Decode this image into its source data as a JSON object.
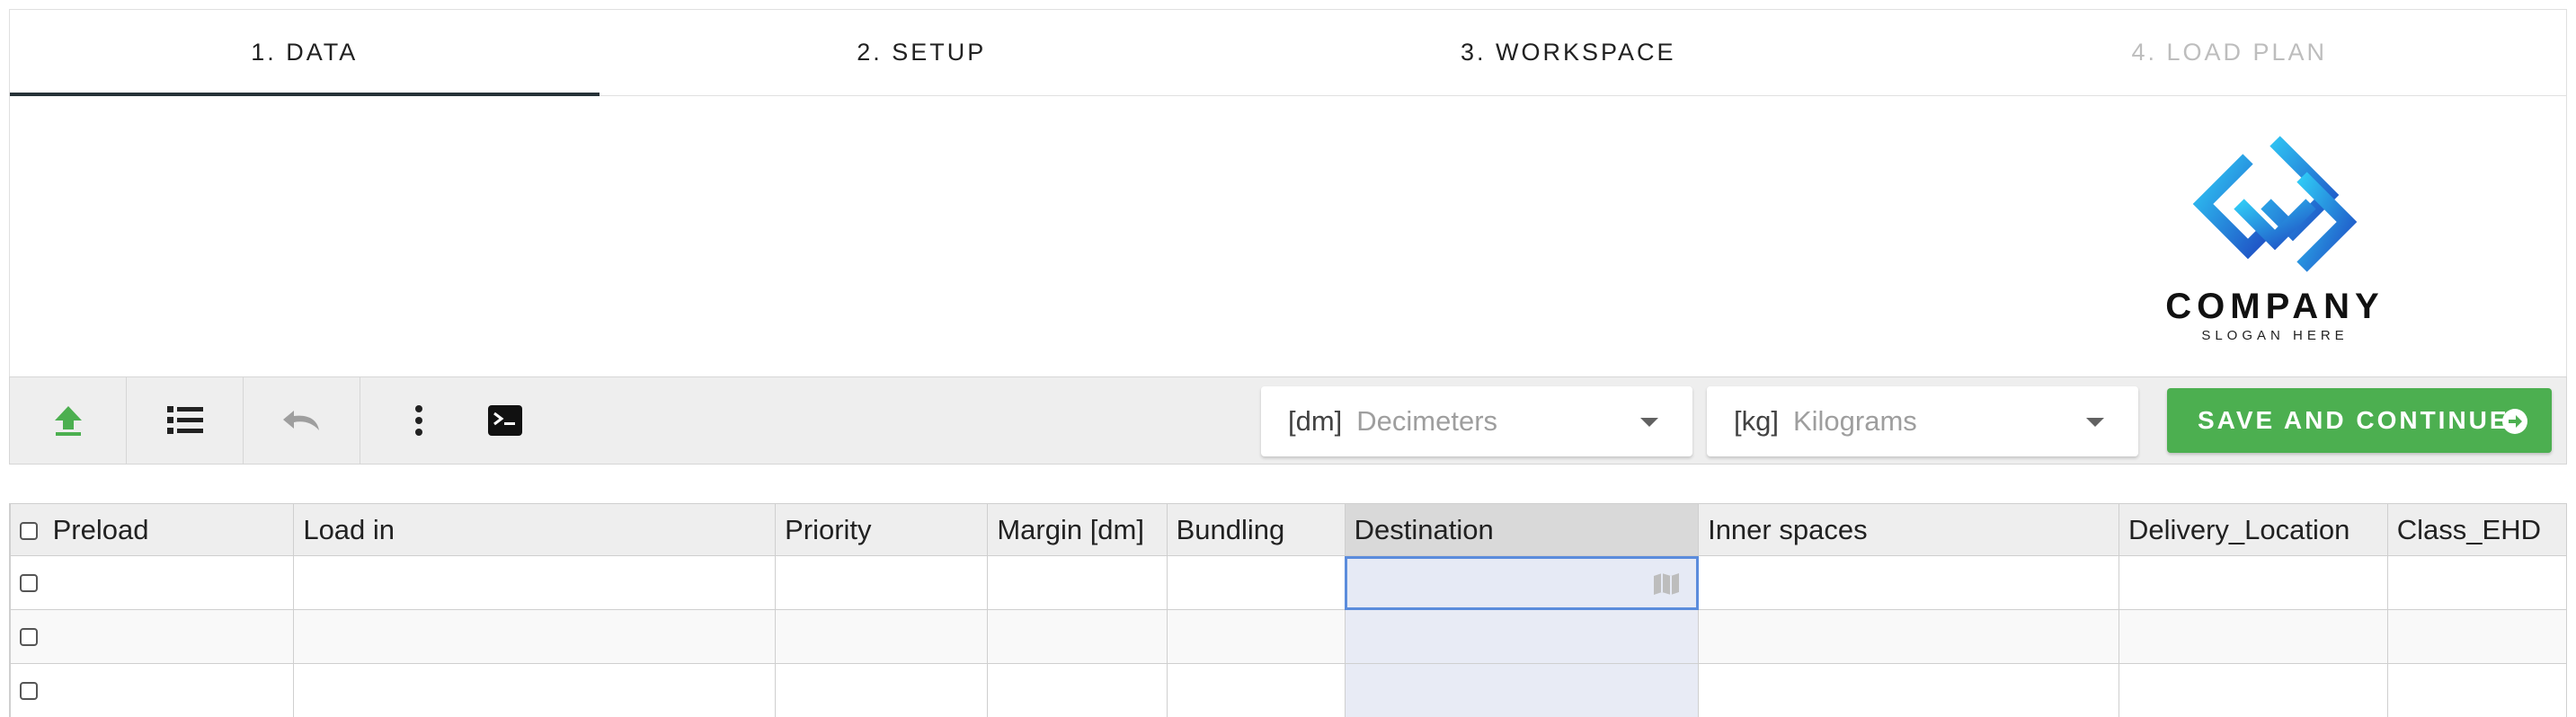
{
  "tabs": [
    {
      "label": "1. DATA",
      "state": "active"
    },
    {
      "label": "2. SETUP",
      "state": "enabled"
    },
    {
      "label": "3. WORKSPACE",
      "state": "enabled"
    },
    {
      "label": "4. LOAD PLAN",
      "state": "disabled"
    }
  ],
  "logo": {
    "name": "COMPANY",
    "slogan": "SLOGAN HERE"
  },
  "toolbar": {
    "buttons": [
      "upload-icon",
      "list-icon",
      "undo-icon",
      "more-vert-icon",
      "console-icon"
    ],
    "length_unit": {
      "unit": "[dm]",
      "value": "Decimeters"
    },
    "weight_unit": {
      "unit": "[kg]",
      "value": "Kilograms"
    },
    "save_label": "SAVE AND CONTINUE"
  },
  "grid": {
    "columns": [
      "Preload",
      "Load in",
      "Priority",
      "Margin [dm]",
      "Bundling",
      "Destination",
      "Inner spaces",
      "Delivery_Location",
      "Class_EHD"
    ],
    "highlighted_column": "Destination",
    "row_count": 3
  },
  "colors": {
    "accent_green": "#4caf50",
    "tab_indicator": "#263238",
    "selection_blue": "#5b8cdc"
  }
}
